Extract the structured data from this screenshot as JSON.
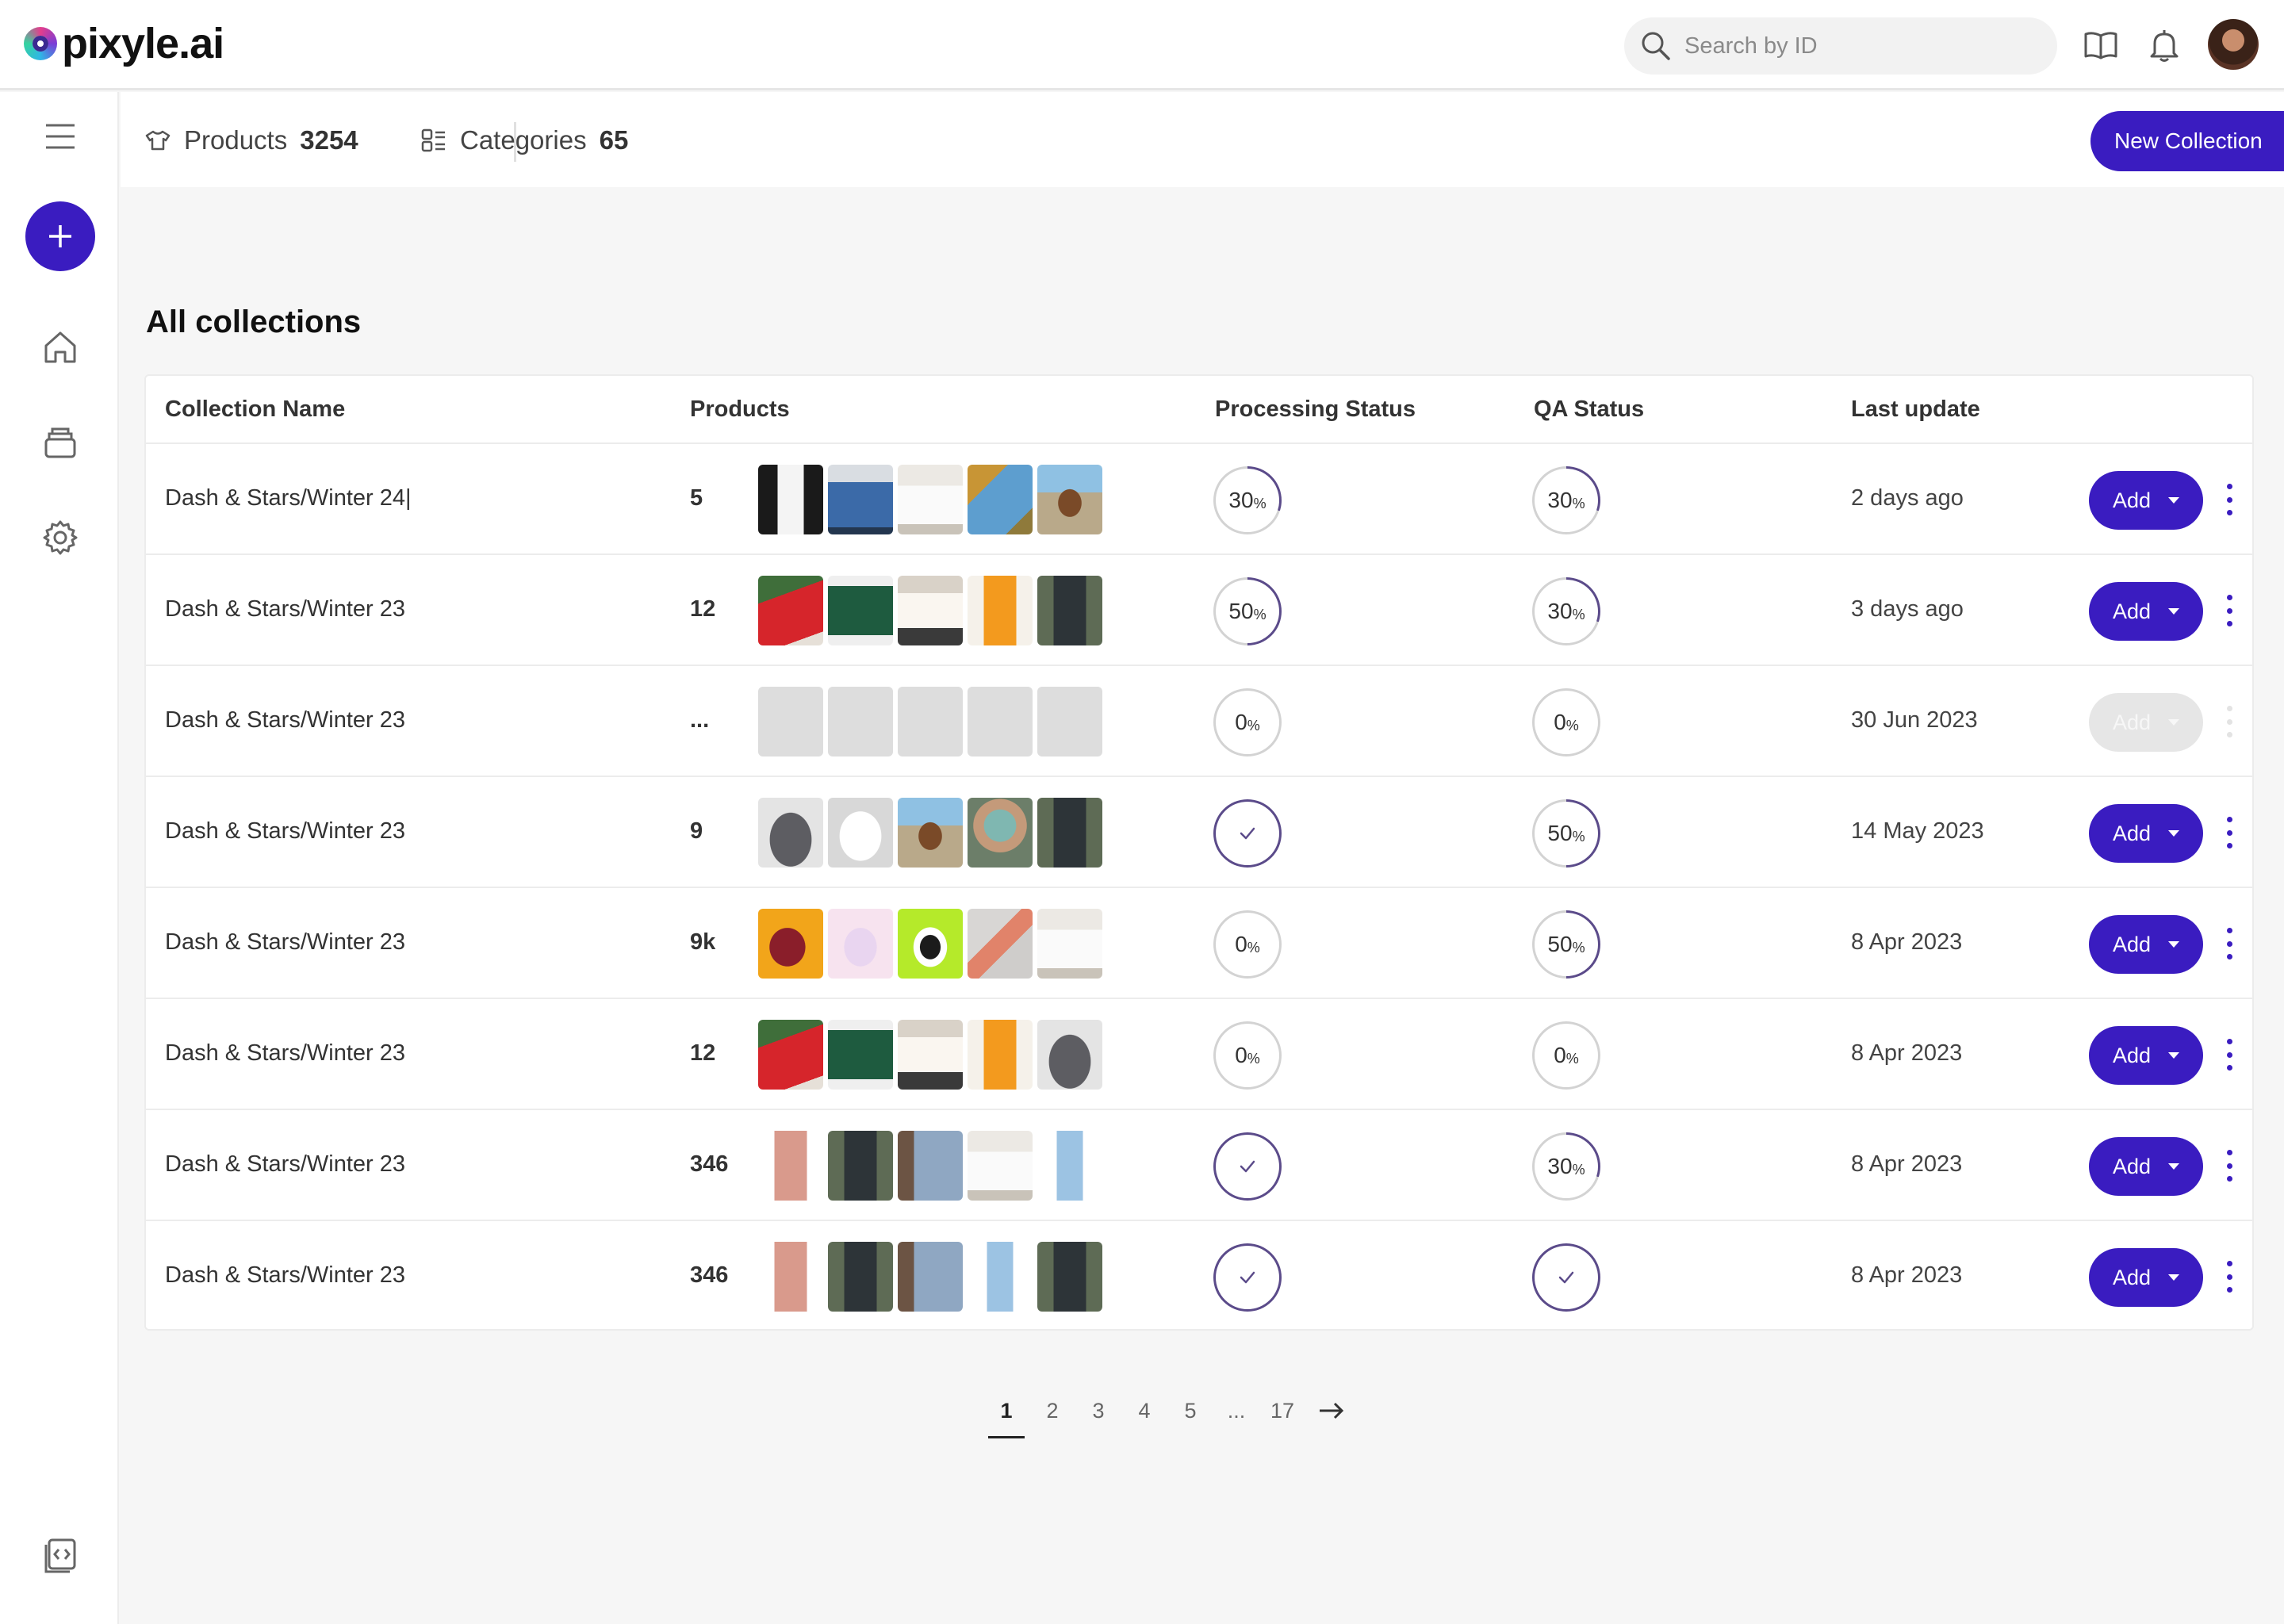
{
  "app": {
    "name": "pixyle.ai"
  },
  "search": {
    "placeholder": "Search by ID"
  },
  "header_icons": [
    "book-icon",
    "bell-icon",
    "avatar"
  ],
  "subheader": {
    "products_label": "Products",
    "products_count": "3254",
    "categories_label": "Categories",
    "categories_count": "65",
    "new_collection_label": "New Collection"
  },
  "page": {
    "title": "All collections"
  },
  "table": {
    "columns": [
      "Collection Name",
      "Products",
      "Processing Status",
      "QA Status",
      "Last update"
    ],
    "rows": [
      {
        "name": "Dash & Stars/Winter 24|",
        "count": "5",
        "processing": 30,
        "qa": 30,
        "processing_done": false,
        "qa_done": false,
        "date": "2 days ago",
        "add": "Add",
        "disabled": false,
        "thumbs": [
          "suit-white-shirt",
          "man-blue-shirt",
          "man-white-shirt",
          "man-denim-shirt",
          "hat-landscape"
        ]
      },
      {
        "name": "Dash & Stars/Winter 23",
        "count": "12",
        "processing": 50,
        "qa": 30,
        "processing_done": false,
        "qa_done": false,
        "date": "3 days ago",
        "add": "Add",
        "disabled": false,
        "thumbs": [
          "red-dress",
          "green-dress",
          "white-dress",
          "orange-dress",
          "dark-jeans"
        ]
      },
      {
        "name": "Dash & Stars/Winter 23",
        "count": "...",
        "processing": 0,
        "qa": 0,
        "processing_done": false,
        "qa_done": false,
        "date": "30 Jun 2023",
        "add": "Add",
        "disabled": true,
        "thumbs": [
          "placeholder",
          "placeholder",
          "placeholder",
          "placeholder",
          "placeholder"
        ]
      },
      {
        "name": "Dash & Stars/Winter 23",
        "count": "9",
        "processing": 100,
        "qa": 50,
        "processing_done": true,
        "qa_done": false,
        "date": "14 May 2023",
        "add": "Add",
        "disabled": false,
        "thumbs": [
          "grey-cap",
          "white-cap",
          "hat-landscape",
          "teal-cap",
          "dark-jeans"
        ]
      },
      {
        "name": "Dash & Stars/Winter 23",
        "count": "9k",
        "processing": 0,
        "qa": 50,
        "processing_done": false,
        "qa_done": false,
        "date": "8 Apr 2023",
        "add": "Add",
        "disabled": false,
        "thumbs": [
          "red-sneaker",
          "pastel-sneaker",
          "green-sneaker",
          "pink-sneaker",
          "man-white-shirt"
        ]
      },
      {
        "name": "Dash & Stars/Winter 23",
        "count": "12",
        "processing": 0,
        "qa": 0,
        "processing_done": false,
        "qa_done": false,
        "date": "8 Apr 2023",
        "add": "Add",
        "disabled": false,
        "thumbs": [
          "red-dress",
          "green-dress",
          "white-dress",
          "orange-dress",
          "grey-cap"
        ]
      },
      {
        "name": "Dash & Stars/Winter 23",
        "count": "346",
        "processing": 100,
        "qa": 30,
        "processing_done": true,
        "qa_done": false,
        "date": "8 Apr 2023",
        "add": "Add",
        "disabled": false,
        "thumbs": [
          "pink-joggers",
          "dark-jeans",
          "blue-jeans-closeup",
          "man-white-shirt",
          "light-jeans"
        ]
      },
      {
        "name": "Dash & Stars/Winter 23",
        "count": "346",
        "processing": 100,
        "qa": 100,
        "processing_done": true,
        "qa_done": true,
        "date": "8 Apr 2023",
        "add": "Add",
        "disabled": false,
        "thumbs": [
          "pink-joggers",
          "dark-jeans",
          "blue-jeans-closeup",
          "light-jeans",
          "dark-jeans"
        ]
      }
    ]
  },
  "pagination": {
    "pages": [
      "1",
      "2",
      "3",
      "4",
      "5",
      "...",
      "17"
    ],
    "active": "1"
  },
  "colors": {
    "accent": "#3a1cc0",
    "ring_progress": "#5b4b8a",
    "ring_track": "#d3d3d3",
    "background": "#f6f6f6"
  }
}
